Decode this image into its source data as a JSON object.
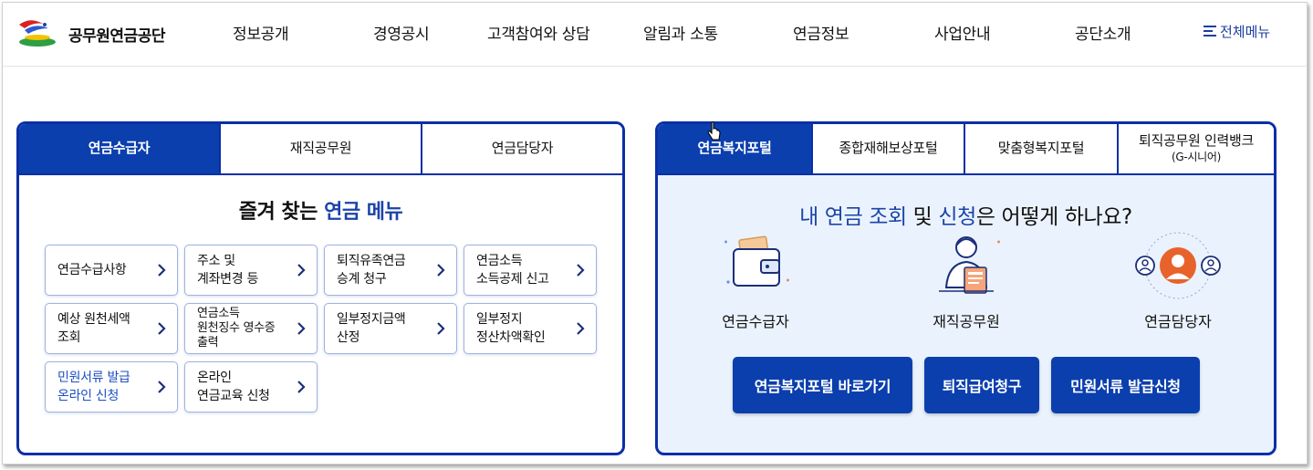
{
  "brand": {
    "name": "공무원연금공단",
    "colors": {
      "primary": "#0b3fae",
      "accent_red": "#d72323",
      "accent_green": "#2f9e44",
      "accent_yellow": "#f2c300"
    }
  },
  "nav": {
    "items": [
      "정보공개",
      "경영공시",
      "고객참여와 상담",
      "알림과 소통",
      "연금정보",
      "사업안내",
      "공단소개"
    ],
    "all_menu": "전체메뉴"
  },
  "left_panel": {
    "tabs": [
      "연금수급자",
      "재직공무원",
      "연금담당자"
    ],
    "title_prefix": "즐겨 찾는",
    "title_highlight": "연금 메뉴",
    "cards": [
      "연금수급사항",
      "주소 및\n계좌변경 등",
      "퇴직유족연금\n승계 청구",
      "연금소득\n소득공제 신고",
      "예상 원천세액\n조회",
      "연금소득\n원천징수 영수증\n출력",
      "일부정지금액\n산정",
      "일부정지\n정산차액확인",
      "민원서류 발급\n온라인 신청",
      "온라인\n연금교육 신청"
    ]
  },
  "right_panel": {
    "tabs": [
      {
        "label": "연금복지포털",
        "sub": ""
      },
      {
        "label": "종합재해보상포털",
        "sub": ""
      },
      {
        "label": "맞춤형복지포털",
        "sub": ""
      },
      {
        "label": "퇴직공무원 인력뱅크",
        "sub": "(G-시니어)"
      }
    ],
    "title": {
      "hl1": "내 연금 조회",
      "mid": " 및 ",
      "hl2": "신청",
      "rest": "은 어떻게 하나요?"
    },
    "personas": [
      "연금수급자",
      "재직공무원",
      "연금담당자"
    ],
    "buttons": [
      "연금복지포털 바로가기",
      "퇴직급여청구",
      "민원서류 발급신청"
    ]
  },
  "icons": [
    "logo-icon",
    "menu-icon",
    "chevron-right-icon",
    "wallet-icon",
    "employee-icon",
    "manager-icon",
    "cursor-icon"
  ]
}
